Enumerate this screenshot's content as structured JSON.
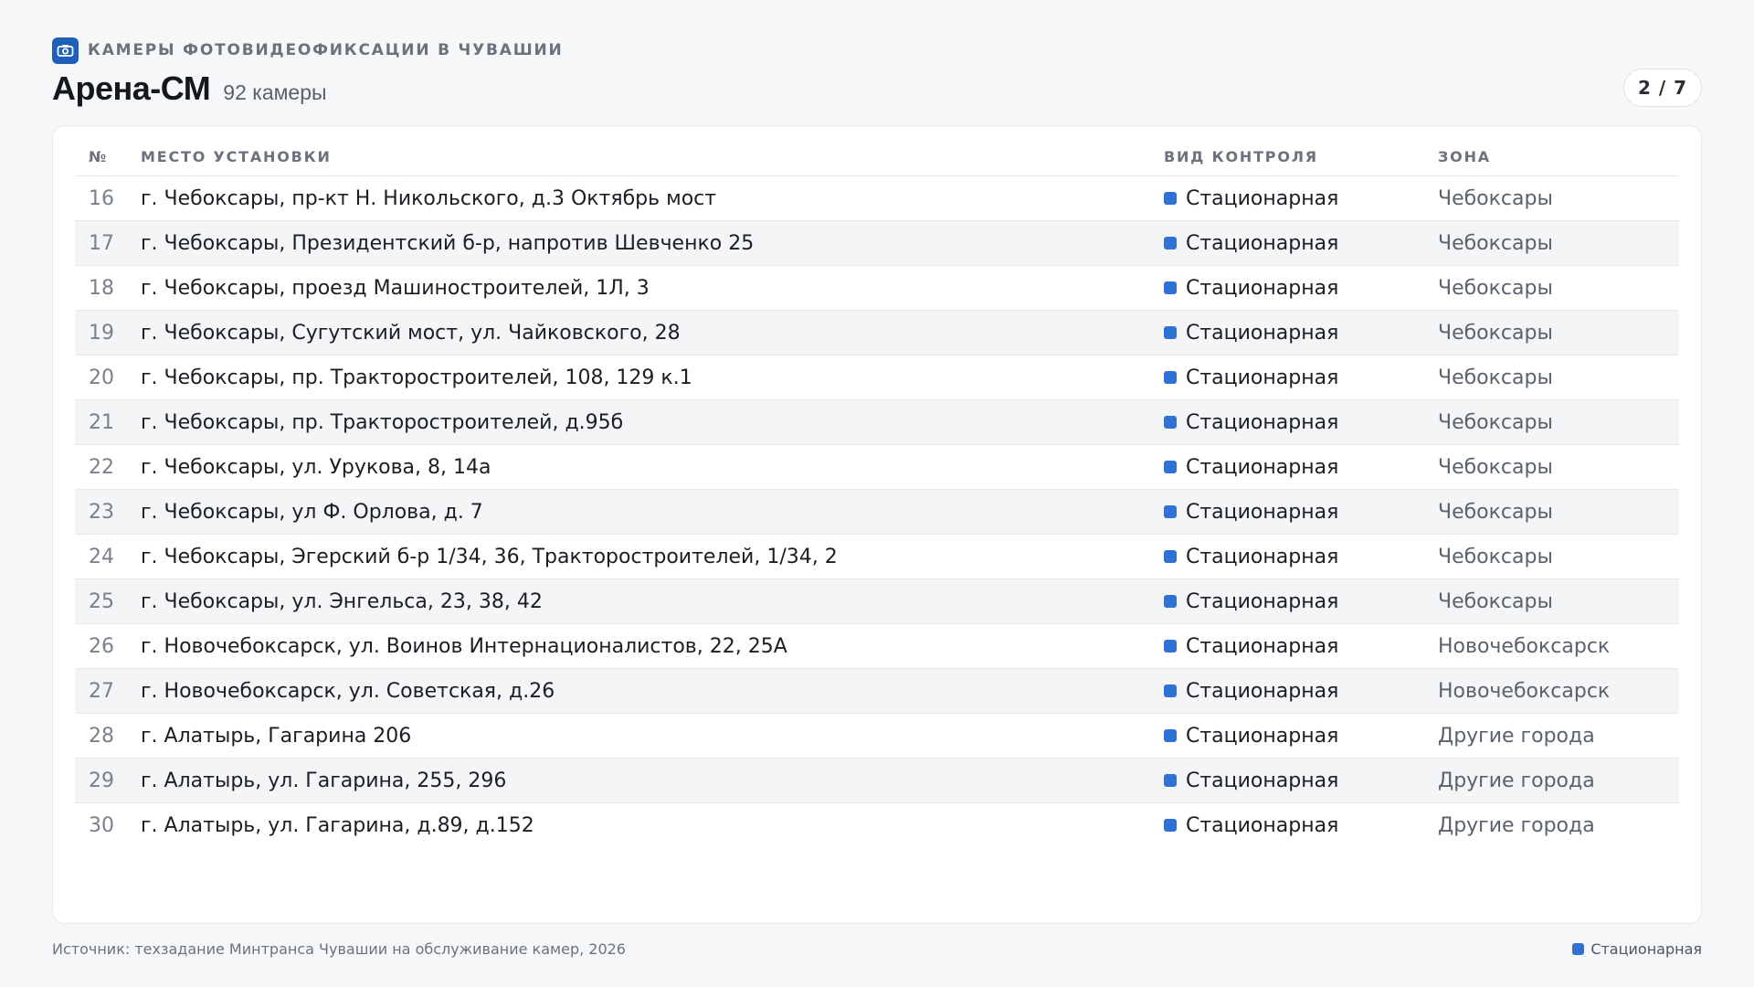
{
  "header": {
    "kicker": "КАМЕРЫ ФОТОВИДЕОФИКСАЦИИ В ЧУВАШИИ",
    "kicker_icon": "camera-icon",
    "title": "Арена-СМ",
    "subtitle": "92 камеры",
    "pager": "2 / 7"
  },
  "colors": {
    "accent": "#1f5fb8",
    "type_stationary": "#2f72d6"
  },
  "table": {
    "columns": [
      "№",
      "МЕСТО УСТАНОВКИ",
      "ВИД КОНТРОЛЯ",
      "ЗОНА"
    ],
    "rows": [
      {
        "num": "16",
        "place": "г. Чебоксары, пр-кт Н. Никольского, д.3 Октябрь мост",
        "type": "Стационарная",
        "zone": "Чебоксары"
      },
      {
        "num": "17",
        "place": "г. Чебоксары, Президентский б-р, напротив Шевченко 25",
        "type": "Стационарная",
        "zone": "Чебоксары"
      },
      {
        "num": "18",
        "place": "г. Чебоксары, проезд Машиностроителей, 1Л, 3",
        "type": "Стационарная",
        "zone": "Чебоксары"
      },
      {
        "num": "19",
        "place": "г. Чебоксары, Сугутский мост, ул. Чайковского, 28",
        "type": "Стационарная",
        "zone": "Чебоксары"
      },
      {
        "num": "20",
        "place": "г. Чебоксары, пр. Тракторостроителей, 108, 129 к.1",
        "type": "Стационарная",
        "zone": "Чебоксары"
      },
      {
        "num": "21",
        "place": "г. Чебоксары, пр. Тракторостроителей, д.95б",
        "type": "Стационарная",
        "zone": "Чебоксары"
      },
      {
        "num": "22",
        "place": "г. Чебоксары, ул. Урукова, 8, 14а",
        "type": "Стационарная",
        "zone": "Чебоксары"
      },
      {
        "num": "23",
        "place": "г. Чебоксары, ул Ф. Орлова, д. 7",
        "type": "Стационарная",
        "zone": "Чебоксары"
      },
      {
        "num": "24",
        "place": "г. Чебоксары, Эгерский б-р 1/34, 36, Тракторостроителей, 1/34, 2",
        "type": "Стационарная",
        "zone": "Чебоксары"
      },
      {
        "num": "25",
        "place": "г. Чебоксары, ул. Энгельса, 23, 38, 42",
        "type": "Стационарная",
        "zone": "Чебоксары"
      },
      {
        "num": "26",
        "place": "г. Новочебоксарск, ул. Воинов Интернационалистов, 22, 25А",
        "type": "Стационарная",
        "zone": "Новочебоксарск"
      },
      {
        "num": "27",
        "place": "г. Новочебоксарск, ул. Советская, д.26",
        "type": "Стационарная",
        "zone": "Новочебоксарск"
      },
      {
        "num": "28",
        "place": "г. Алатырь, Гагарина 206",
        "type": "Стационарная",
        "zone": "Другие города"
      },
      {
        "num": "29",
        "place": "г. Алатырь, ул. Гагарина, 255, 296",
        "type": "Стационарная",
        "zone": "Другие города"
      },
      {
        "num": "30",
        "place": "г. Алатырь, ул. Гагарина, д.89, д.152",
        "type": "Стационарная",
        "zone": "Другие города"
      }
    ]
  },
  "footer": {
    "source": "Источник: техзадание Минтранса Чувашии на обслуживание камер, 2026",
    "legend_label": "Стационарная"
  }
}
